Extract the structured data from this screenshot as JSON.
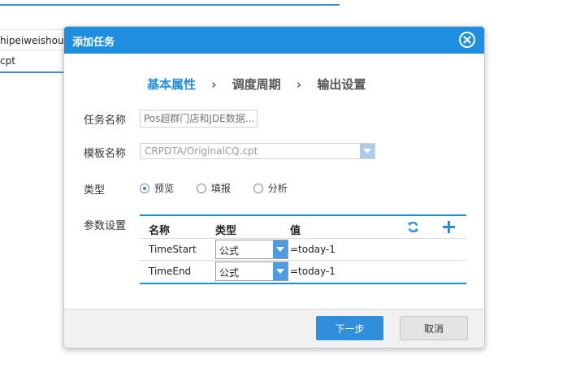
{
  "background": {
    "list": [
      "hipeiweishouhu",
      "cpt"
    ]
  },
  "dialog": {
    "title": "添加任务",
    "steps": [
      "基本属性",
      "调度周期",
      "输出设置"
    ],
    "step_separator": "›",
    "fields": {
      "task_name_label": "任务名称",
      "task_name_placeholder": "Pos超群门店和JDE数据...",
      "template_label": "模板名称",
      "template_value": "CRPDTA/OriginalCQ.cpt",
      "type_label": "类型",
      "type_options": [
        "预览",
        "填报",
        "分析"
      ],
      "type_selected": "预览",
      "params_label": "参数设置"
    },
    "params": {
      "headers": [
        "名称",
        "类型",
        "值"
      ],
      "rows": [
        {
          "name": "TimeStart",
          "type": "公式",
          "value": "=today-1"
        },
        {
          "name": "TimeEnd",
          "type": "公式",
          "value": "=today-1"
        }
      ]
    },
    "buttons": {
      "next": "下一步",
      "cancel": "取消"
    },
    "colors": {
      "accent": "#1e8fe0",
      "header": "#1e8fe0"
    }
  }
}
